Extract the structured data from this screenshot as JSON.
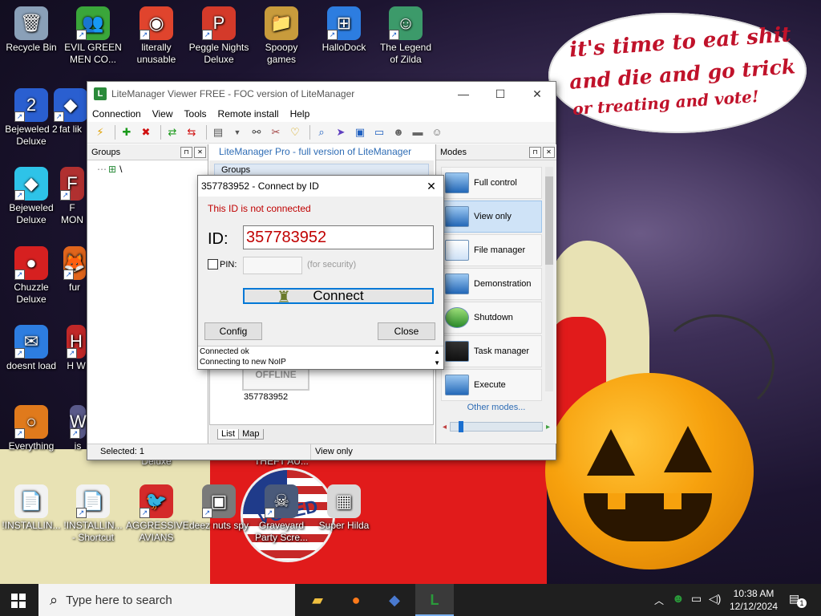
{
  "desktop": {
    "speech": [
      "it's time to eat shit",
      "and die and go trick",
      "or treating and vote!"
    ],
    "icons": [
      {
        "label": "Recycle Bin",
        "color": "#8aa0b8",
        "glyph": "🗑"
      },
      {
        "label": "EVIL GREEN MEN CO...",
        "color": "#3aa63a",
        "glyph": "👥"
      },
      {
        "label": "literally unusable",
        "color": "#e0442d",
        "glyph": "◉"
      },
      {
        "label": "Peggle Nights Deluxe",
        "color": "#d43a2a",
        "glyph": "P"
      },
      {
        "label": "Spoopy games",
        "color": "#c89b3c",
        "glyph": "📁"
      },
      {
        "label": "HalloDock",
        "color": "#2d7de0",
        "glyph": "⊞"
      },
      {
        "label": "The Legend of Zilda",
        "color": "#3c9a6a",
        "glyph": "☺"
      },
      {
        "label": "Bejeweled 2 Deluxe",
        "color": "#2a5fd0",
        "glyph": "2"
      },
      {
        "label": "fat lik",
        "color": "#2a5fd0",
        "glyph": "◆"
      },
      {
        "label": "Bejeweled Deluxe",
        "color": "#2ec3e8",
        "glyph": "◆"
      },
      {
        "label": "F MON",
        "color": "#b03030",
        "glyph": "F"
      },
      {
        "label": "Chuzzle Deluxe",
        "color": "#d62020",
        "glyph": "●"
      },
      {
        "label": "fur",
        "color": "#e0651c",
        "glyph": "🦊"
      },
      {
        "label": "doesnt load",
        "color": "#2d7de0",
        "glyph": "✉"
      },
      {
        "label": "H W",
        "color": "#c02828",
        "glyph": "H"
      },
      {
        "label": "Everything",
        "color": "#e07a1c",
        "glyph": "○"
      },
      {
        "label": "is",
        "color": "#5a5a8a",
        "glyph": "W"
      },
      {
        "label": "!INSTALLIN...",
        "color": "#f2f2f2",
        "glyph": "📄"
      },
      {
        "label": "!INSTALLIN... - Shortcut",
        "color": "#f2f2f2",
        "glyph": "📄"
      },
      {
        "label": "AGGRESSIVE AVIANS",
        "color": "#d42a2a",
        "glyph": "🐦"
      },
      {
        "label": "deez nuts spy",
        "color": "#7a7a7a",
        "glyph": "▣"
      },
      {
        "label": "Graveyard Party Scre...",
        "color": "#4a5a7a",
        "glyph": "☠"
      },
      {
        "label": "Super Hilda",
        "color": "#d8d8d8",
        "glyph": "▦"
      },
      {
        "label": "Deluxe",
        "color": "transparent",
        "glyph": ""
      },
      {
        "label": "THEFT AU...",
        "color": "transparent",
        "glyph": ""
      }
    ],
    "voted_badge": "VOTED"
  },
  "lm": {
    "title": "LiteManager Viewer FREE - FOC version of LiteManager",
    "menu": [
      "Connection",
      "View",
      "Tools",
      "Remote install",
      "Help"
    ],
    "groups_header": "Groups",
    "groups_root": "\\",
    "center_banner": "LiteManager Pro - full version of LiteManager",
    "center_groups": "Groups",
    "card_status": "OFFLINE",
    "card_id": "357783952",
    "tabs": [
      "List",
      "Map"
    ],
    "modes_header": "Modes",
    "modes": [
      "Full control",
      "View only",
      "File manager",
      "Demonstration",
      "Shutdown",
      "Task manager",
      "Execute"
    ],
    "other_modes": "Other modes...",
    "status_selected": "Selected: 1",
    "status_mode": "View only"
  },
  "dlg": {
    "title": "357783952 - Connect by ID",
    "error": "This ID is not connected",
    "id_label": "ID:",
    "id_value": "357783952",
    "pin_label": "PIN:",
    "pin_hint": "(for security)",
    "connect": "Connect",
    "config": "Config",
    "close": "Close",
    "log": [
      "Connected ok",
      "Connecting to new NoIP"
    ]
  },
  "taskbar": {
    "search_placeholder": "Type here to search",
    "time": "10:38 AM",
    "date": "12/12/2024",
    "notifications": "1"
  },
  "colors": {
    "error_red": "#c00000",
    "accent_blue": "#0078d7"
  }
}
